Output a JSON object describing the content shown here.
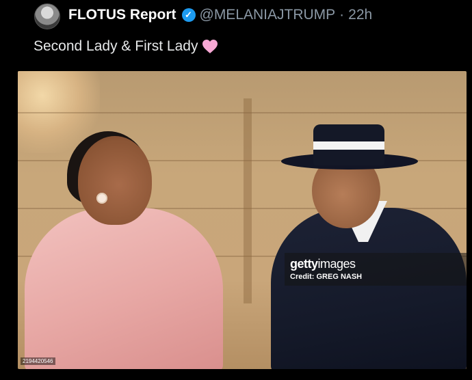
{
  "post": {
    "display_name": "FLOTUS Report",
    "handle": "@MELANIAJTRUMP",
    "separator": "·",
    "time": "22h",
    "text": "Second Lady & First Lady",
    "emoji_icon": "pink-heart-icon",
    "verified_icon": "verified-badge-icon",
    "colors": {
      "verified": "#1d9bf0",
      "heart": "#f7a8d4",
      "text": "#e7e9ea",
      "muted": "#8b98a5"
    }
  },
  "media": {
    "watermark_logo_bold": "getty",
    "watermark_logo_regular": "images",
    "watermark_credit": "Credit: GREG NASH",
    "image_id": "2194420546"
  }
}
